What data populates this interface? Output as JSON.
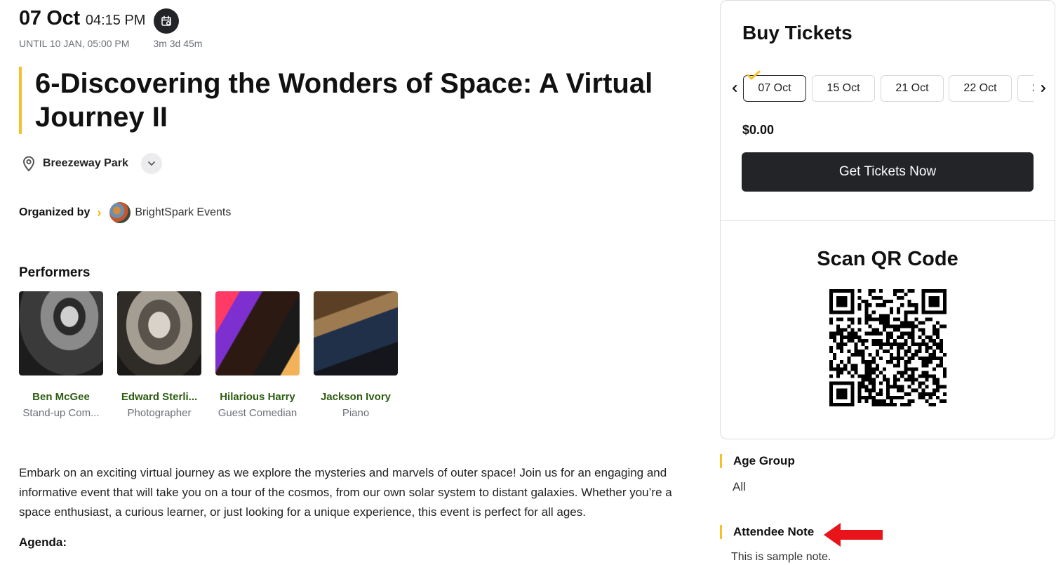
{
  "event": {
    "date": "07 Oct",
    "time": "04:15 PM",
    "until": "UNTIL 10 JAN, 05:00 PM",
    "duration": "3m 3d 45m",
    "title": "6-Discovering the Wonders of Space: A Virtual Journey II",
    "venue": "Breezeway Park",
    "organized_by_label": "Organized by",
    "organizer": "BrightSpark Events",
    "icons": {
      "calendar": "calendar-icon",
      "pin": "map-pin-icon",
      "chevron": "chevron-down-icon",
      "arrow": "chevron-right-icon"
    }
  },
  "performers": {
    "heading": "Performers",
    "items": [
      {
        "name": "Ben McGee",
        "role": "Stand-up Com..."
      },
      {
        "name": "Edward Sterli...",
        "role": "Photographer"
      },
      {
        "name": "Hilarious Harry",
        "role": "Guest Comedian"
      },
      {
        "name": "Jackson Ivory",
        "role": "Piano"
      }
    ]
  },
  "description": "Embark on an exciting virtual journey as we explore the mysteries and marvels of outer space! Join us for an engaging and informative event that will take you on a tour of the cosmos, from our own solar system to distant galaxies. Whether you’re a space enthusiast, a curious learner, or just looking for a unique experience, this event is perfect for all ages.",
  "agenda_label": "Agenda:",
  "tickets": {
    "title": "Buy Tickets",
    "dates": [
      "07 Oct",
      "15 Oct",
      "21 Oct",
      "22 Oct",
      "2"
    ],
    "selected_date": "07 Oct",
    "price": "$0.00",
    "button": "Get Tickets Now"
  },
  "qr": {
    "title": "Scan QR Code"
  },
  "age_group": {
    "label": "Age Group",
    "value": "All"
  },
  "attendee_note": {
    "label": "Attendee Note",
    "value": "This is sample note."
  },
  "colors": {
    "accent": "#f5c02a",
    "dark": "#222428",
    "performer_name": "#2e5d12",
    "annotation_arrow": "#e8141a"
  }
}
